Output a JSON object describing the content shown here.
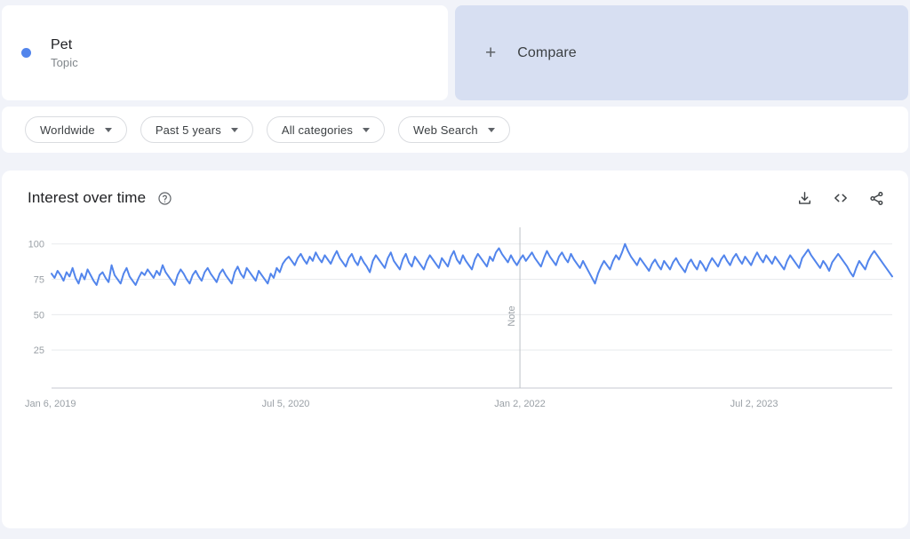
{
  "search_terms": [
    {
      "label": "Pet",
      "type_label": "Topic",
      "color": "#5285ec"
    }
  ],
  "compare": {
    "label": "Compare",
    "plus_icon": "plus-icon"
  },
  "filters": [
    {
      "name": "location",
      "label": "Worldwide"
    },
    {
      "name": "time-range",
      "label": "Past 5 years"
    },
    {
      "name": "category",
      "label": "All categories"
    },
    {
      "name": "search-type",
      "label": "Web Search"
    }
  ],
  "chart_panel": {
    "title": "Interest over time",
    "help_icon": "help-circle-icon",
    "actions": [
      {
        "name": "download-icon",
        "label": "Download"
      },
      {
        "name": "embed-icon",
        "label": "Embed"
      },
      {
        "name": "share-icon",
        "label": "Share"
      }
    ]
  },
  "chart_data": {
    "type": "line",
    "title": "Interest over time",
    "xlabel": "",
    "ylabel": "",
    "ylim": [
      0,
      108
    ],
    "yticks": [
      25,
      50,
      75,
      100
    ],
    "grid": true,
    "legend": false,
    "line_color": "#5285ec",
    "line_width": 2,
    "xticks": [
      {
        "label": "Jan 6, 2019",
        "index": 0
      },
      {
        "label": "Jul 5, 2020",
        "index": 78
      },
      {
        "label": "Jan 2, 2022",
        "index": 156
      },
      {
        "label": "Jul 2, 2023",
        "index": 234
      }
    ],
    "annotations": [
      {
        "type": "vertical-line",
        "label": "Note",
        "index": 156
      }
    ],
    "series": [
      {
        "name": "Pet",
        "values": [
          79,
          76,
          81,
          78,
          74,
          80,
          77,
          83,
          76,
          72,
          79,
          75,
          82,
          78,
          74,
          71,
          78,
          80,
          76,
          73,
          85,
          78,
          75,
          72,
          79,
          83,
          77,
          74,
          71,
          76,
          80,
          78,
          82,
          79,
          76,
          81,
          78,
          85,
          80,
          77,
          74,
          71,
          78,
          82,
          79,
          75,
          72,
          78,
          81,
          77,
          74,
          80,
          83,
          79,
          76,
          73,
          79,
          82,
          78,
          75,
          72,
          80,
          84,
          79,
          76,
          83,
          80,
          77,
          74,
          81,
          78,
          75,
          72,
          79,
          76,
          83,
          80,
          86,
          89,
          91,
          88,
          85,
          90,
          93,
          89,
          86,
          91,
          88,
          94,
          90,
          87,
          92,
          89,
          86,
          91,
          95,
          90,
          87,
          84,
          90,
          93,
          88,
          85,
          91,
          87,
          84,
          80,
          88,
          92,
          89,
          86,
          83,
          90,
          94,
          88,
          85,
          82,
          89,
          93,
          87,
          84,
          91,
          88,
          85,
          82,
          88,
          92,
          89,
          86,
          83,
          90,
          87,
          84,
          91,
          95,
          89,
          86,
          92,
          88,
          85,
          82,
          89,
          93,
          90,
          87,
          84,
          91,
          88,
          94,
          97,
          93,
          90,
          87,
          92,
          88,
          85,
          89,
          92,
          88,
          91,
          94,
          90,
          87,
          84,
          90,
          95,
          91,
          88,
          85,
          91,
          94,
          90,
          87,
          93,
          89,
          86,
          83,
          88,
          84,
          80,
          76,
          72,
          79,
          84,
          88,
          85,
          82,
          88,
          92,
          89,
          94,
          100,
          95,
          91,
          88,
          85,
          90,
          87,
          84,
          81,
          86,
          89,
          85,
          82,
          88,
          85,
          82,
          87,
          90,
          86,
          83,
          80,
          86,
          89,
          85,
          82,
          88,
          85,
          81,
          86,
          90,
          87,
          84,
          89,
          92,
          88,
          85,
          90,
          93,
          89,
          86,
          91,
          88,
          85,
          90,
          94,
          90,
          87,
          92,
          89,
          86,
          91,
          88,
          85,
          82,
          88,
          92,
          89,
          86,
          83,
          90,
          93,
          96,
          92,
          89,
          86,
          83,
          88,
          85,
          81,
          87,
          90,
          93,
          90,
          87,
          84,
          80,
          77,
          83,
          88,
          85,
          82,
          88,
          92,
          95,
          92,
          89,
          86,
          83,
          80,
          77
        ]
      }
    ]
  }
}
